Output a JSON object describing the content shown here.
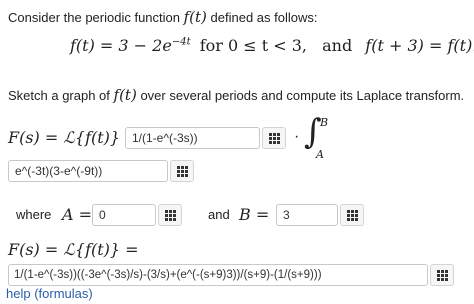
{
  "intro": {
    "prefix": "Consider the periodic function",
    "func": "f(t)",
    "suffix": "defined as follows:"
  },
  "definition": {
    "lhs": "f(t) = 3 − 2e",
    "exp": "−4t",
    "cond": "for 0 ≤ t < 3,",
    "and": "and",
    "periodic": "f(t + 3) = f(t)."
  },
  "task": {
    "prefix": "Sketch a graph of",
    "func": "f(t)",
    "suffix": "over several periods and compute its Laplace transform."
  },
  "laplace1": {
    "lhs": "F(s) = ℒ{f(t)} =",
    "input1": "1/(1-e^(-3s))",
    "dot": "·",
    "integral": "∫",
    "upper": "B",
    "lower": "A",
    "input2": "e^(-3t)(3-e^(-9t))"
  },
  "limits": {
    "where": "where",
    "a_label": "A =",
    "a_value": "0",
    "and": "and",
    "b_label": "B =",
    "b_value": "3"
  },
  "laplace2": {
    "lhs": "F(s) = ℒ{f(t)} =",
    "input": "1/(1-e^(-3s))((-3e^(-3s)/s)-(3/s)+(e^(-(s+9)3))/(s+9)-(1/(s+9)))"
  },
  "help": {
    "label": "help (formulas)"
  },
  "icons": {
    "keypad": "keypad-grid-icon"
  }
}
